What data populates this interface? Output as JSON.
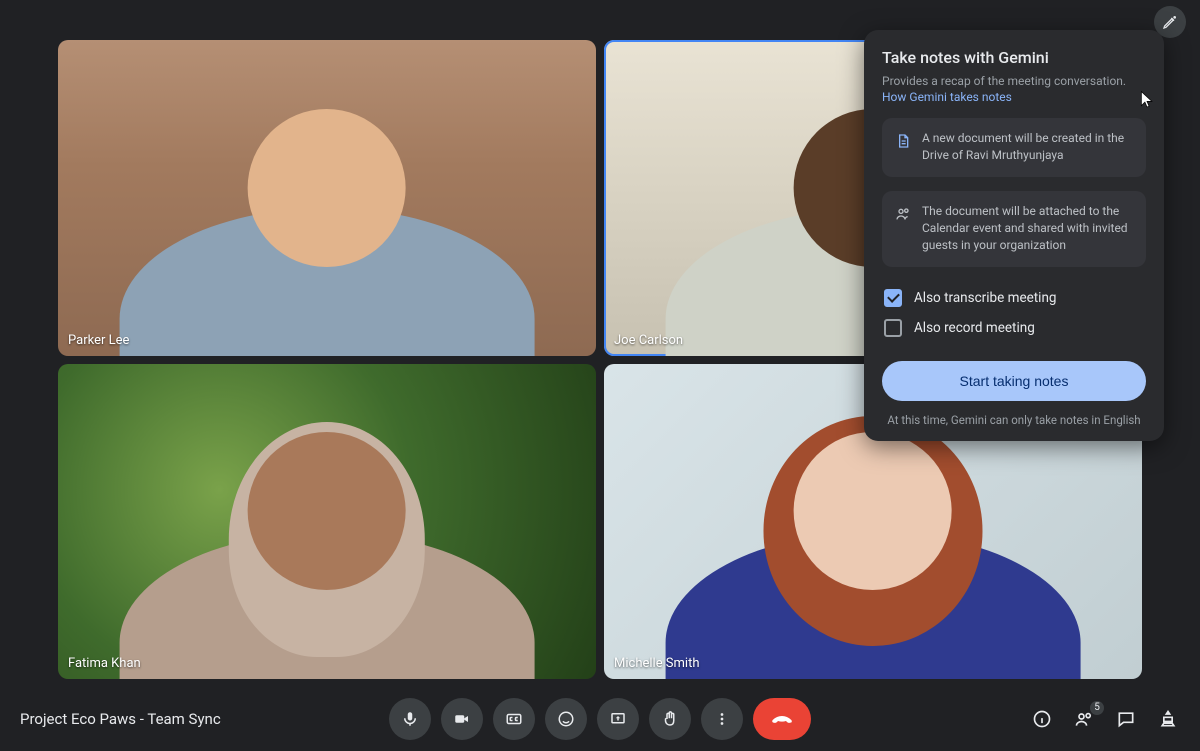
{
  "participants": [
    {
      "name": "Parker Lee",
      "active": false
    },
    {
      "name": "Joe Carlson",
      "active": true
    },
    {
      "name": "Fatima Khan",
      "active": false
    },
    {
      "name": "Michelle Smith",
      "active": false
    }
  ],
  "meeting": {
    "title": "Project Eco Paws - Team Sync",
    "participant_count": "5"
  },
  "panel": {
    "title": "Take notes with Gemini",
    "subtitle": "Provides a recap of the meeting conversation.",
    "link": "How Gemini takes notes",
    "info1": "A new document will be created in the Drive of Ravi Mruthyunjaya",
    "info2": "The document will be attached to the Calendar event and shared with invited guests in your organization",
    "check_transcribe": "Also transcribe meeting",
    "check_record": "Also record meeting",
    "start_button": "Start taking notes",
    "disclaimer": "At this time, Gemini can only take notes in English"
  }
}
